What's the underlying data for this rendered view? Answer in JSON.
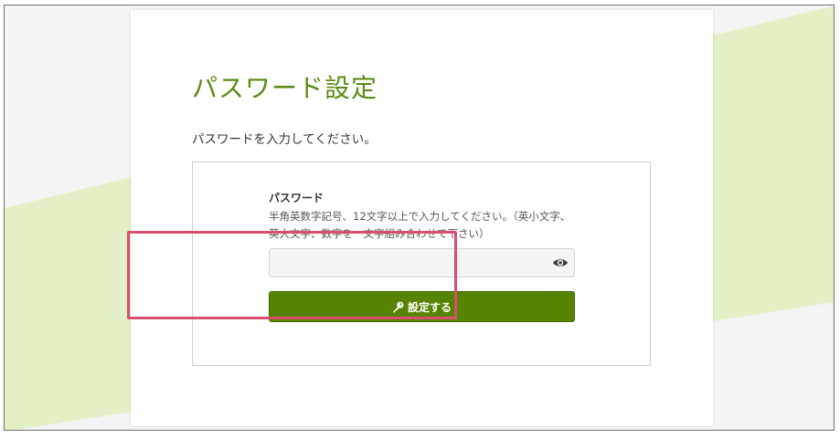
{
  "page": {
    "title": "パスワード設定",
    "instruction": "パスワードを入力してください。"
  },
  "form": {
    "label": "パスワード",
    "help": "半角英数字記号、12文字以上で入力してください。（英小文字、英大文字、数字を一文字組み合わせて下さい）",
    "password": {
      "value": "",
      "placeholder": "",
      "toggle_icon": "eye-icon"
    },
    "submit": {
      "label": "設定する",
      "icon": "key-icon"
    }
  },
  "colors": {
    "accent": "#578400",
    "title": "#5a8a12",
    "highlight": "#d84e6f",
    "background_band": "#e3f0c6"
  }
}
